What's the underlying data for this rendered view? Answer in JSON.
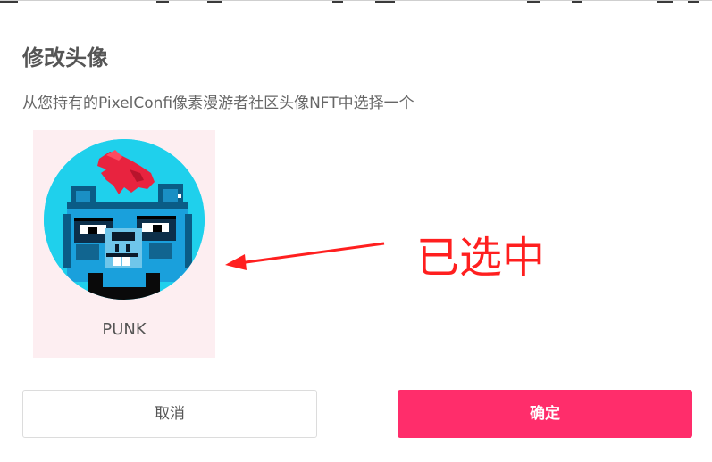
{
  "dialog": {
    "title": "修改头像",
    "subtitle": "从您持有的PixelConfi像素漫游者社区头像NFT中选择一个"
  },
  "nft_items": [
    {
      "label": "PUNK",
      "selected": true,
      "icon": "pixel-bear-punk-avatar"
    }
  ],
  "annotation": {
    "text": "已选中",
    "color": "#ff1f1f"
  },
  "buttons": {
    "cancel_label": "取消",
    "confirm_label": "确定"
  },
  "colors": {
    "accent": "#ff2d6b",
    "selected_card_bg": "#fdeef1",
    "avatar_bg": "#1fd0ec"
  }
}
